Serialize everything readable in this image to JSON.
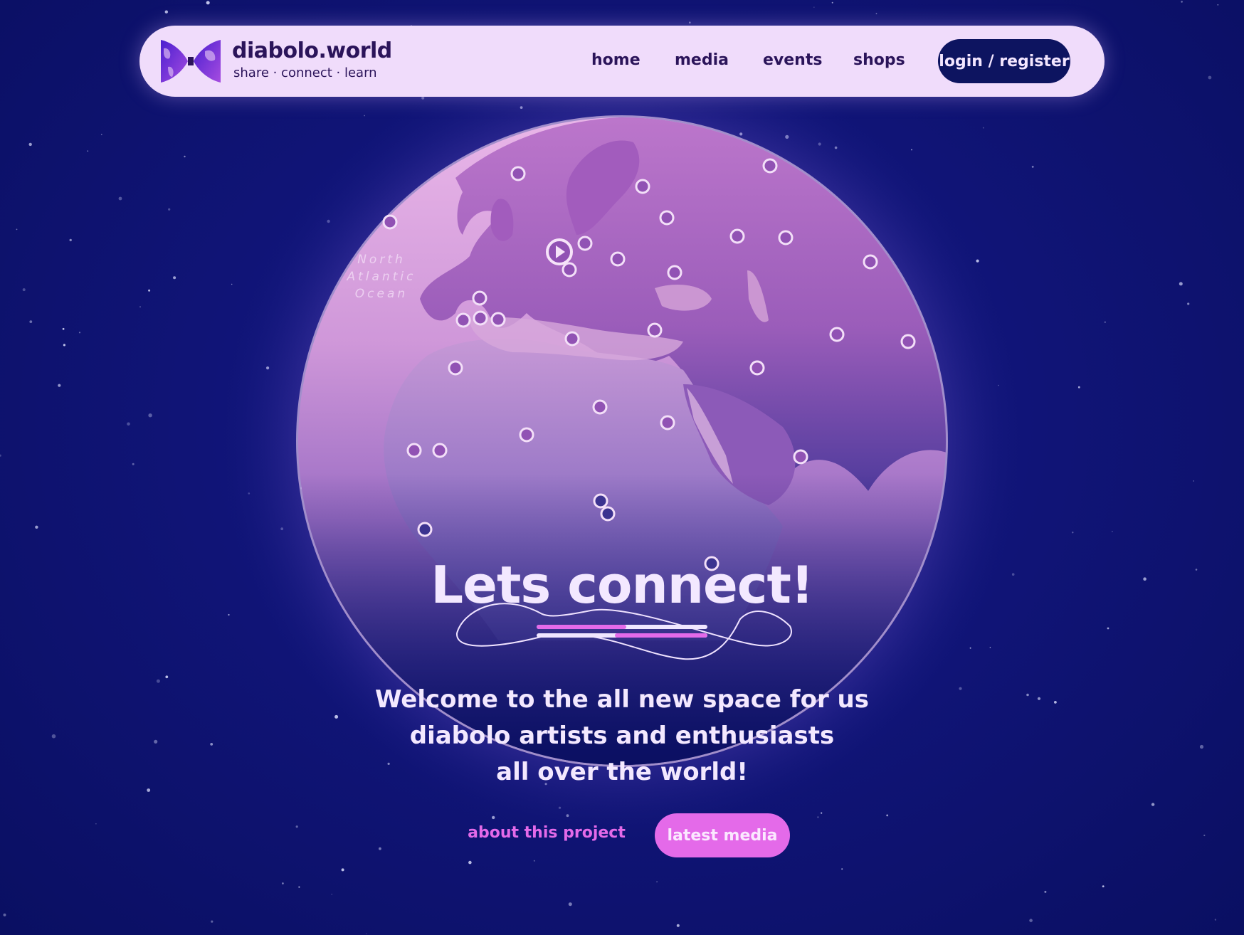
{
  "site": {
    "name": "diabolo.world",
    "tagline": "share · connect · learn",
    "logo_icon": "diabolo-globe-logo"
  },
  "nav": {
    "links": [
      "home",
      "media",
      "events",
      "shops"
    ],
    "login_label": "login / register"
  },
  "map": {
    "ocean_label_lines": [
      "North",
      "Atlantic",
      "Ocean"
    ],
    "marker_icon": "location-dot-icon",
    "featured_icon": "play-icon"
  },
  "hero": {
    "title": "Lets connect!",
    "welcome_lines": [
      "Welcome to the all new space for us",
      "diabolo artists and enthusiasts",
      "all over the world!"
    ],
    "about_label": "about this project",
    "latest_label": "latest media"
  },
  "colors": {
    "background": "#0d1266",
    "nav_bg": "#f0dcfb",
    "dark_text": "#2b145a",
    "accent_pink": "#e46ae9",
    "login_bg": "#0d1460"
  }
}
